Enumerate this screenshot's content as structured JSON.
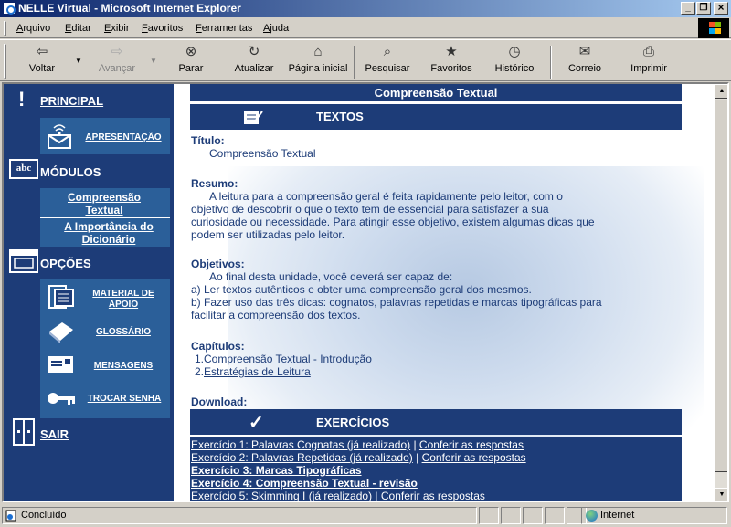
{
  "window": {
    "title": "NELLE Virtual - Microsoft Internet Explorer",
    "min": "_",
    "max": "❐",
    "close": "×"
  },
  "menu": [
    "Arquivo",
    "Editar",
    "Exibir",
    "Favoritos",
    "Ferramentas",
    "Ajuda"
  ],
  "toolbar": {
    "back": "Voltar",
    "forward": "Avançar",
    "stop": "Parar",
    "refresh": "Atualizar",
    "home": "Página inicial",
    "search": "Pesquisar",
    "favorites": "Favoritos",
    "history": "Histórico",
    "mail": "Correio",
    "print": "Imprimir"
  },
  "sidebar": {
    "principal": "PRINCIPAL",
    "apresentacao": "APRESENTAÇÃO",
    "modulos": "MÓDULOS",
    "modulo_items": [
      "Compreensão Textual",
      "A Importância do Dicionário"
    ],
    "opcoes": "OPÇÕES",
    "opcoes_items": [
      "MATERIAL DE APOIO",
      "GLOSSÁRIO",
      "MENSAGENS",
      "TROCAR SENHA"
    ],
    "sair": "SAIR"
  },
  "content": {
    "header": "Compreensão Textual",
    "textos": "TEXTOS",
    "titulo_label": "Título:",
    "titulo_value": "Compreensão Textual",
    "resumo_label": "Resumo:",
    "resumo_lines": [
      "A leitura para a compreensão geral é feita rapidamente pelo leitor, com o",
      "objetivo de descobrir o que o texto tem de essencial para satisfazer a sua",
      "curiosidade ou necessidade. Para atingir esse objetivo, existem algumas dicas que",
      "podem ser utilizadas pelo leitor."
    ],
    "objetivos_label": "Objetivos:",
    "objetivos_lines": [
      "Ao final desta unidade, você deverá ser capaz de:",
      "a) Ler textos autênticos e obter uma compreensão geral dos mesmos.",
      "b) Fazer uso das três dicas: cognatos, palavras repetidas e marcas tipográficas para",
      "facilitar a compreensão dos textos."
    ],
    "capitulos_label": "Capítulos:",
    "capitulos": [
      {
        "num": "1.",
        "label": "Compreensão Textual - Introdução"
      },
      {
        "num": "2.",
        "label": "Estratégias de Leitura"
      }
    ],
    "download_label": "Download:",
    "exercicios": "EXERCÍCIOS",
    "exercise_list": [
      {
        "label": "Exercício 1: Palavras Cognatas (já realizado)",
        "sep": " | ",
        "answer": "Conferir as respostas"
      },
      {
        "label": "Exercício 2: Palavras Repetidas (já realizado)",
        "sep": " | ",
        "answer": "Conferir as respostas"
      },
      {
        "label": "Exercício 3: Marcas Tipográficas",
        "sep": "",
        "answer": ""
      },
      {
        "label": "Exercício 4: Compreensão Textual - revisão",
        "sep": "",
        "answer": ""
      },
      {
        "label": "Exercício 5: Skimming I (já realizado)",
        "sep": " | ",
        "answer": "Conferir as respostas"
      }
    ]
  },
  "status": {
    "left": "Concluído",
    "zone": "Internet"
  }
}
